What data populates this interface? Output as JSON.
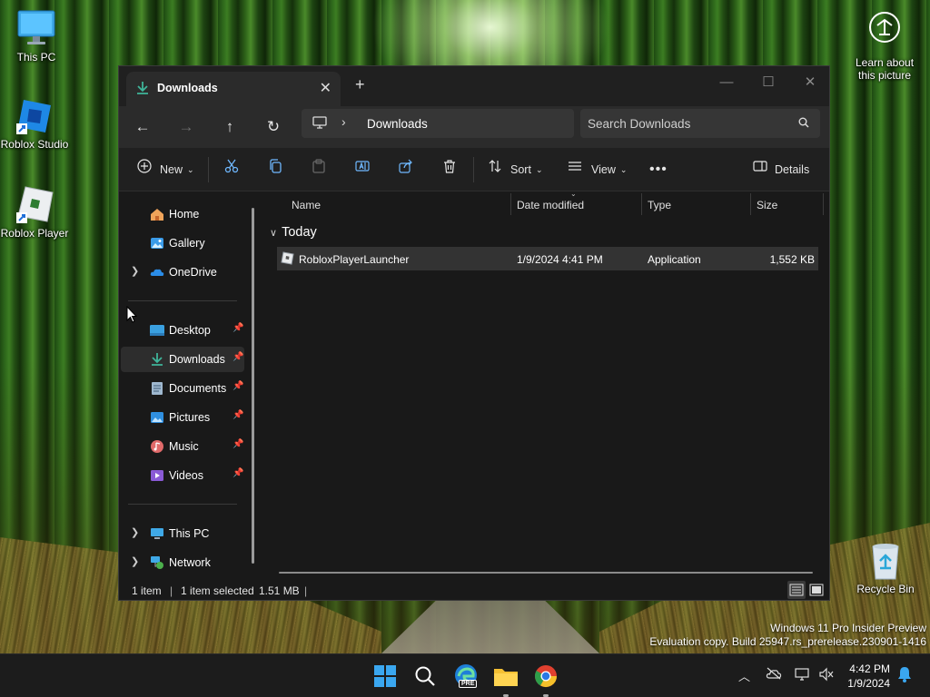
{
  "desktop": {
    "icons": [
      {
        "label": "This PC"
      },
      {
        "label": "Roblox Studio"
      },
      {
        "label": "Roblox Player"
      },
      {
        "label": "Recycle Bin"
      }
    ],
    "learn_label_line1": "Learn about",
    "learn_label_line2": "this picture",
    "watermark_line1": "Windows 11 Pro Insider Preview",
    "watermark_line2": "Evaluation copy. Build 25947.rs_prerelease.230901-1416"
  },
  "explorer": {
    "tab_title": "Downloads",
    "nav": {
      "address_crumb": "Downloads",
      "search_placeholder": "Search Downloads"
    },
    "toolbar": {
      "new_label": "New",
      "sort_label": "Sort",
      "view_label": "View",
      "details_label": "Details"
    },
    "sidebar": {
      "items": [
        {
          "label": "Home"
        },
        {
          "label": "Gallery"
        },
        {
          "label": "OneDrive"
        },
        {
          "label": "Desktop"
        },
        {
          "label": "Downloads"
        },
        {
          "label": "Documents"
        },
        {
          "label": "Pictures"
        },
        {
          "label": "Music"
        },
        {
          "label": "Videos"
        },
        {
          "label": "This PC"
        },
        {
          "label": "Network"
        }
      ]
    },
    "columns": [
      "Name",
      "Date modified",
      "Type",
      "Size"
    ],
    "group_label": "Today",
    "files": [
      {
        "name": "RobloxPlayerLauncher",
        "date": "1/9/2024 4:41 PM",
        "type": "Application",
        "size": "1,552 KB"
      }
    ],
    "status": {
      "count": "1 item",
      "selected": "1 item selected",
      "size": "1.51 MB"
    }
  },
  "taskbar": {
    "time": "4:42 PM",
    "date": "1/9/2024",
    "edge_badge": "PRE"
  }
}
